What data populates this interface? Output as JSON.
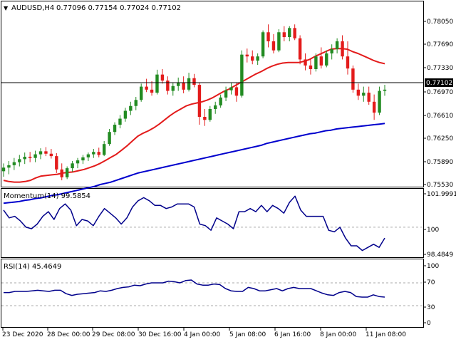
{
  "header": {
    "arrow_glyph": "▼",
    "symbol_tf": "AUDUSD,H4",
    "ohlc": "0.77096 0.77154 0.77024 0.77102"
  },
  "colors": {
    "bull": "#228b22",
    "bear": "#e31b1b",
    "ma_fast": "#e31b1b",
    "ma_slow": "#0000cd",
    "momentum": "#00008b",
    "rsi": "#00008b",
    "axis": "#000000",
    "price_tag_bg": "#000000",
    "price_tag_fg": "#ffffff",
    "level_line": "#a9a9a9"
  },
  "chart_data": [
    {
      "type": "candlestick",
      "title": "AUDUSD,H4",
      "ylim": [
        0.7553,
        0.7823
      ],
      "y_ticks": [
        "0.78050",
        "0.77690",
        "0.77330",
        "0.76970",
        "0.76610",
        "0.76250",
        "0.75890",
        "0.75530"
      ],
      "current_price": "0.77102",
      "candles": [
        [
          0.7575,
          0.7588,
          0.7566,
          0.7581
        ],
        [
          0.7581,
          0.7592,
          0.757,
          0.7585
        ],
        [
          0.7585,
          0.7597,
          0.7577,
          0.759
        ],
        [
          0.759,
          0.7602,
          0.7583,
          0.7595
        ],
        [
          0.7595,
          0.7606,
          0.7587,
          0.7599
        ],
        [
          0.7599,
          0.7607,
          0.759,
          0.7597
        ],
        [
          0.7597,
          0.7609,
          0.759,
          0.7603
        ],
        [
          0.7603,
          0.7613,
          0.7595,
          0.7608
        ],
        [
          0.7608,
          0.7615,
          0.76,
          0.7604
        ],
        [
          0.7604,
          0.7612,
          0.7596,
          0.76
        ],
        [
          0.76,
          0.7605,
          0.7572,
          0.7578
        ],
        [
          0.7578,
          0.7588,
          0.756,
          0.7565
        ],
        [
          0.7565,
          0.7583,
          0.7562,
          0.758
        ],
        [
          0.758,
          0.7592,
          0.7574,
          0.7588
        ],
        [
          0.7588,
          0.7597,
          0.758,
          0.7593
        ],
        [
          0.7593,
          0.7602,
          0.7587,
          0.7598
        ],
        [
          0.7598,
          0.7606,
          0.7592,
          0.7603
        ],
        [
          0.7603,
          0.7612,
          0.7597,
          0.7607
        ],
        [
          0.7607,
          0.7614,
          0.7598,
          0.7602
        ],
        [
          0.7602,
          0.7625,
          0.76,
          0.762
        ],
        [
          0.762,
          0.7645,
          0.7617,
          0.764
        ],
        [
          0.764,
          0.7656,
          0.7635,
          0.7652
        ],
        [
          0.7652,
          0.7668,
          0.7646,
          0.7662
        ],
        [
          0.7662,
          0.768,
          0.7657,
          0.7675
        ],
        [
          0.7675,
          0.769,
          0.7668,
          0.7683
        ],
        [
          0.7683,
          0.7698,
          0.7676,
          0.7693
        ],
        [
          0.7693,
          0.772,
          0.769,
          0.7715
        ],
        [
          0.7715,
          0.7728,
          0.7706,
          0.771
        ],
        [
          0.771,
          0.7724,
          0.77,
          0.7705
        ],
        [
          0.7705,
          0.7743,
          0.7702,
          0.7735
        ],
        [
          0.7735,
          0.7744,
          0.772,
          0.7725
        ],
        [
          0.7725,
          0.7732,
          0.7702,
          0.7708
        ],
        [
          0.7708,
          0.7722,
          0.77,
          0.7716
        ],
        [
          0.7716,
          0.773,
          0.7708,
          0.7722
        ],
        [
          0.7722,
          0.7732,
          0.7704,
          0.771
        ],
        [
          0.771,
          0.7738,
          0.7707,
          0.7729
        ],
        [
          0.7729,
          0.7736,
          0.7714,
          0.7718
        ],
        [
          0.7718,
          0.7722,
          0.7652,
          0.7665
        ],
        [
          0.7665,
          0.7678,
          0.765,
          0.766
        ],
        [
          0.766,
          0.7683,
          0.7657,
          0.7678
        ],
        [
          0.7678,
          0.769,
          0.767,
          0.7684
        ],
        [
          0.7684,
          0.7702,
          0.768,
          0.7697
        ],
        [
          0.7697,
          0.7715,
          0.7691,
          0.7709
        ],
        [
          0.7709,
          0.7722,
          0.7702,
          0.7714
        ],
        [
          0.7714,
          0.7722,
          0.769,
          0.77
        ],
        [
          0.77,
          0.7775,
          0.7697,
          0.7768
        ],
        [
          0.7768,
          0.7778,
          0.7755,
          0.7765
        ],
        [
          0.7765,
          0.7775,
          0.7752,
          0.7758
        ],
        [
          0.7758,
          0.777,
          0.7751,
          0.7765
        ],
        [
          0.7765,
          0.7808,
          0.7762,
          0.7805
        ],
        [
          0.7805,
          0.7818,
          0.778,
          0.779
        ],
        [
          0.779,
          0.7802,
          0.777,
          0.7775
        ],
        [
          0.7775,
          0.781,
          0.7772,
          0.7805
        ],
        [
          0.7805,
          0.7815,
          0.779,
          0.7797
        ],
        [
          0.7797,
          0.7815,
          0.779,
          0.7812
        ],
        [
          0.7812,
          0.7818,
          0.7792,
          0.7795
        ],
        [
          0.7795,
          0.78,
          0.7752,
          0.776
        ],
        [
          0.776,
          0.777,
          0.7742,
          0.775
        ],
        [
          0.775,
          0.7762,
          0.7735,
          0.7744
        ],
        [
          0.7744,
          0.777,
          0.774,
          0.7765
        ],
        [
          0.7765,
          0.778,
          0.7745,
          0.775
        ],
        [
          0.775,
          0.7775,
          0.7747,
          0.777
        ],
        [
          0.777,
          0.7785,
          0.776,
          0.7777
        ],
        [
          0.7777,
          0.7795,
          0.777,
          0.779
        ],
        [
          0.779,
          0.78,
          0.776,
          0.7765
        ],
        [
          0.7765,
          0.779,
          0.7735,
          0.7745
        ],
        [
          0.7745,
          0.775,
          0.7705,
          0.771
        ],
        [
          0.771,
          0.772,
          0.7693,
          0.77
        ],
        [
          0.77,
          0.7715,
          0.769,
          0.7705
        ],
        [
          0.7705,
          0.7715,
          0.7685,
          0.769
        ],
        [
          0.769,
          0.7702,
          0.766,
          0.7672
        ],
        [
          0.7672,
          0.7715,
          0.7668,
          0.7708
        ],
        [
          0.7708,
          0.7718,
          0.77,
          0.771
        ]
      ],
      "indicators": [
        {
          "name": "MA fast",
          "values": [
            0.756,
            0.7558,
            0.7557,
            0.7557,
            0.7558,
            0.756,
            0.7564,
            0.7567,
            0.7568,
            0.7569,
            0.757,
            0.7572,
            0.7573,
            0.7574,
            0.7576,
            0.7578,
            0.7581,
            0.7584,
            0.7588,
            0.7593,
            0.7598,
            0.7603,
            0.761,
            0.7617,
            0.7625,
            0.7633,
            0.7638,
            0.7642,
            0.7647,
            0.7653,
            0.766,
            0.7667,
            0.7673,
            0.7678,
            0.7683,
            0.7686,
            0.7688,
            0.769,
            0.7693,
            0.7697,
            0.7702,
            0.7707,
            0.7711,
            0.7716,
            0.7721,
            0.7726,
            0.7731,
            0.7736,
            0.774,
            0.7745,
            0.7749,
            0.7752,
            0.7754,
            0.7755,
            0.7755,
            0.7755,
            0.7757,
            0.776,
            0.7765,
            0.7769,
            0.7773,
            0.7777,
            0.7778,
            0.7778,
            0.7777,
            0.7773,
            0.777,
            0.7766,
            0.7762,
            0.7758,
            0.7755,
            0.7753
          ]
        },
        {
          "name": "MA slow",
          "values": [
            0.7522,
            0.7523,
            0.7524,
            0.7525,
            0.7527,
            0.7528,
            0.753,
            0.7531,
            0.7533,
            0.7535,
            0.7536,
            0.7538,
            0.754,
            0.7542,
            0.7544,
            0.7546,
            0.7548,
            0.755,
            0.7553,
            0.7555,
            0.7557,
            0.756,
            0.7563,
            0.7566,
            0.7569,
            0.7572,
            0.7574,
            0.7576,
            0.7578,
            0.758,
            0.7582,
            0.7584,
            0.7586,
            0.7588,
            0.759,
            0.7592,
            0.7594,
            0.7596,
            0.7598,
            0.76,
            0.7602,
            0.7604,
            0.7606,
            0.7608,
            0.761,
            0.7612,
            0.7614,
            0.7616,
            0.7618,
            0.7621,
            0.7623,
            0.7625,
            0.7627,
            0.7629,
            0.7631,
            0.7633,
            0.7635,
            0.7637,
            0.7638,
            0.764,
            0.7642,
            0.7643,
            0.7645,
            0.7646,
            0.7647,
            0.7648,
            0.7649,
            0.765,
            0.7651,
            0.7652,
            0.7653,
            0.7654
          ]
        }
      ]
    },
    {
      "type": "line",
      "title": "Momentum(14) 99.5854",
      "ylim": [
        98.25,
        102.15
      ],
      "y_ticks": [
        "101.9991",
        "100",
        "98.4849"
      ],
      "levels": [
        100
      ],
      "series": [
        {
          "name": "Momentum(14)",
          "values": [
            101.1,
            100.6,
            100.7,
            100.4,
            100.0,
            99.9,
            100.2,
            100.7,
            101.0,
            100.5,
            101.2,
            101.5,
            101.1,
            100.1,
            100.5,
            100.4,
            100.1,
            100.7,
            101.2,
            100.9,
            100.6,
            100.2,
            100.6,
            101.3,
            101.7,
            101.9,
            101.7,
            101.4,
            101.4,
            101.2,
            101.3,
            101.5,
            101.5,
            101.5,
            101.3,
            100.2,
            100.1,
            99.8,
            100.6,
            100.4,
            100.2,
            99.9,
            101.0,
            101.0,
            101.2,
            101.0,
            101.4,
            101.0,
            101.4,
            101.2,
            100.9,
            101.6,
            102.0,
            101.1,
            100.7,
            100.7,
            100.7,
            100.7,
            99.8,
            99.7,
            100.0,
            99.3,
            98.8,
            98.8,
            98.5,
            98.7,
            98.9,
            98.7,
            99.3
          ]
        }
      ]
    },
    {
      "type": "line",
      "title": "RSI(14) 45.4649",
      "ylim": [
        0,
        100
      ],
      "y_ticks": [
        "100",
        "70",
        "30",
        "0"
      ],
      "levels": [
        70,
        30
      ],
      "series": [
        {
          "name": "RSI(14)",
          "values": [
            53,
            53,
            55,
            55,
            55,
            56,
            57,
            56,
            55,
            57,
            57,
            51,
            48,
            50,
            51,
            52,
            53,
            56,
            55,
            57,
            60,
            62,
            63,
            66,
            65,
            68,
            70,
            70,
            70,
            73,
            72,
            70,
            74,
            75,
            68,
            66,
            66,
            68,
            67,
            60,
            56,
            55,
            55,
            62,
            60,
            56,
            56,
            58,
            60,
            56,
            60,
            62,
            60,
            60,
            60,
            56,
            52,
            49,
            48,
            53,
            55,
            53,
            46,
            45,
            45,
            49,
            46,
            45
          ]
        }
      ]
    }
  ],
  "x_axis_labels": [
    "23 Dec 2020",
    "28 Dec 00:00",
    "29 Dec 08:00",
    "30 Dec 16:00",
    "4 Jan 00:00",
    "5 Jan 08:00",
    "6 Jan 16:00",
    "8 Jan 00:00",
    "11 Jan 08:00"
  ]
}
